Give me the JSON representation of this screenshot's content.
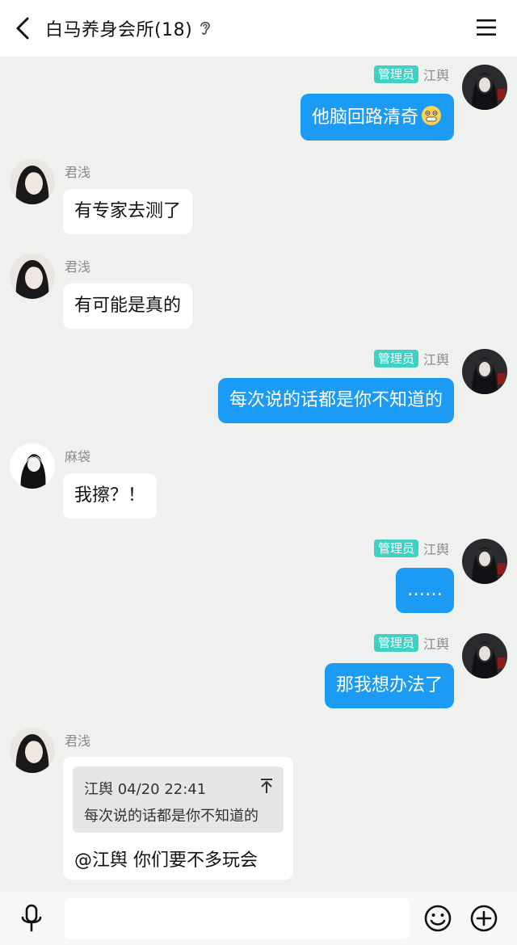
{
  "header": {
    "title": "白马养身会所(18)",
    "back_icon": "chevron-left-icon",
    "listen_icon": "ear-icon",
    "menu_icon": "hamburger-menu-icon"
  },
  "colors": {
    "accent_bubble": "#1c9bf5",
    "admin_badge": "#3fd2c4",
    "background": "#eef1ee"
  },
  "messages": [
    {
      "side": "right",
      "badge": "管理员",
      "sender": "江舆",
      "text": "他脑回路清奇",
      "emoji": "grimacing-face-icon"
    },
    {
      "side": "left",
      "sender": "君浅",
      "text": "有专家去测了"
    },
    {
      "side": "left",
      "sender": "君浅",
      "text": "有可能是真的"
    },
    {
      "side": "right",
      "badge": "管理员",
      "sender": "江舆",
      "text": "每次说的话都是你不知道的"
    },
    {
      "side": "left",
      "sender": "麻袋",
      "text": "我擦？！"
    },
    {
      "side": "right",
      "badge": "管理员",
      "sender": "江舆",
      "text": "……"
    },
    {
      "side": "right",
      "badge": "管理员",
      "sender": "江舆",
      "text": "那我想办法了"
    },
    {
      "side": "left",
      "sender": "君浅",
      "quote": {
        "author_time": "江舆 04/20 22:41",
        "text": "每次说的话都是你不知道的"
      },
      "text": "@江舆 你们要不多玩会"
    }
  ],
  "input_bar": {
    "mic_icon": "microphone-icon",
    "emoji_icon": "smiley-icon",
    "plus_icon": "plus-circle-icon",
    "placeholder": ""
  }
}
